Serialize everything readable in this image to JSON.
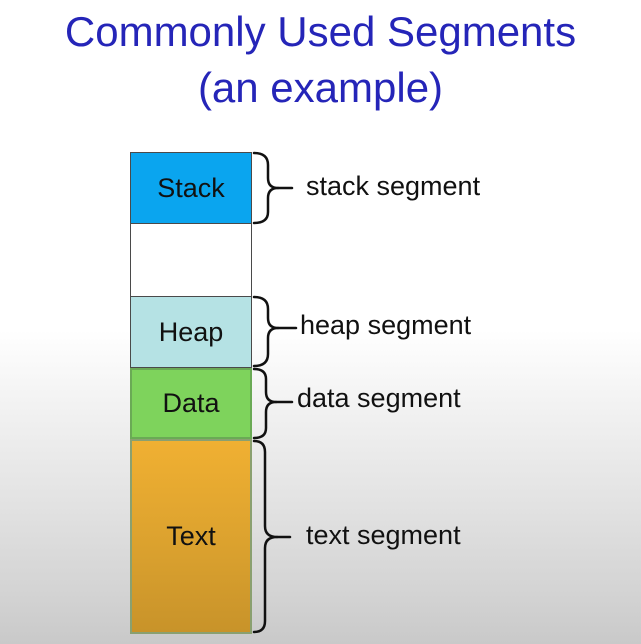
{
  "title": {
    "line1": "Commonly Used Segments",
    "line2": "(an example)"
  },
  "blocks": {
    "stack": "Stack",
    "heap": "Heap",
    "data": "Data",
    "text": "Text"
  },
  "labels": {
    "stack": "stack segment",
    "heap": "heap segment",
    "data": "data segment",
    "text": "text segment"
  },
  "colors": {
    "title": "#2525b8",
    "stack": "#0aa5ef",
    "heap": "#b5e2e4",
    "data": "#7ed35c",
    "text": "#f0b032"
  }
}
